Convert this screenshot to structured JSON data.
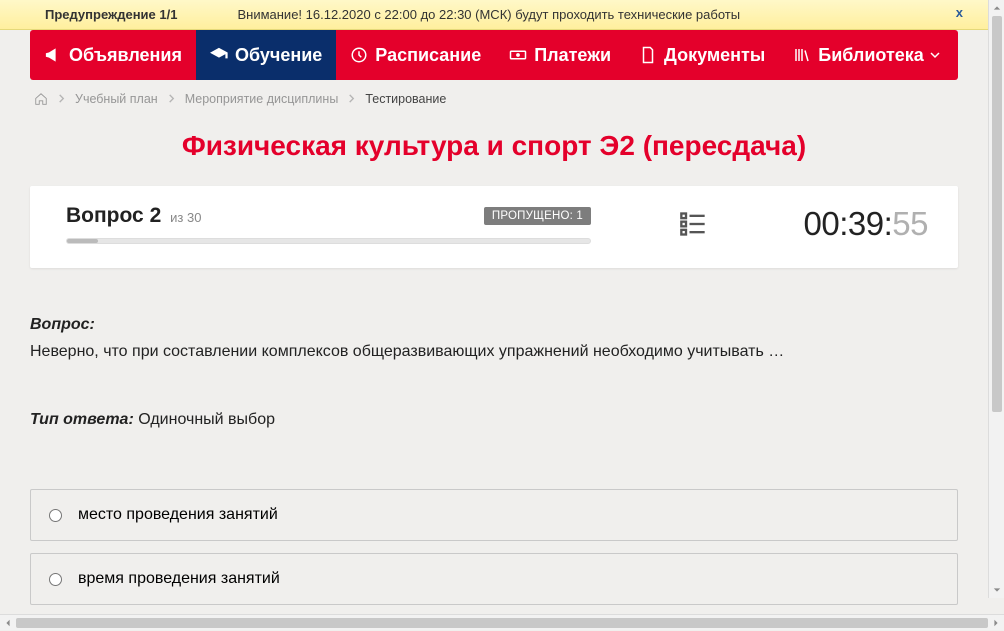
{
  "alert": {
    "title": "Предупреждение 1/1",
    "message": "Внимание! 16.12.2020 с 22:00 до 22:30 (МСК) будут проходить технические работы",
    "close": "x"
  },
  "nav": {
    "items": [
      {
        "label": "Объявления",
        "icon": "megaphone-icon",
        "active": false
      },
      {
        "label": "Обучение",
        "icon": "graduation-icon",
        "active": true
      },
      {
        "label": "Расписание",
        "icon": "clock-icon",
        "active": false
      },
      {
        "label": "Платежи",
        "icon": "banknote-icon",
        "active": false
      },
      {
        "label": "Документы",
        "icon": "document-icon",
        "active": false
      },
      {
        "label": "Библиотека",
        "icon": "bookshelf-icon",
        "active": false,
        "dropdown": true
      }
    ]
  },
  "breadcrumbs": {
    "items": [
      {
        "label": "Учебный план"
      },
      {
        "label": "Мероприятие дисциплины"
      },
      {
        "label": "Тестирование",
        "current": true
      }
    ]
  },
  "page": {
    "title": "Физическая культура и спорт Э2 (пересдача)"
  },
  "status": {
    "question_word": "Вопрос",
    "question_number": "2",
    "of_word": "из",
    "question_total": "30",
    "skipped_label": "ПРОПУЩЕНО: 1",
    "timer_main": "00:39:",
    "timer_sec": "55"
  },
  "question": {
    "label": "Вопрос:",
    "text": "Неверно, что при составлении комплексов общеразвивающих упражнений необходимо учитывать …",
    "answer_type_label": "Тип ответа:",
    "answer_type_value": "Одиночный выбор",
    "options": [
      "место проведения занятий",
      "время проведения занятий"
    ]
  }
}
